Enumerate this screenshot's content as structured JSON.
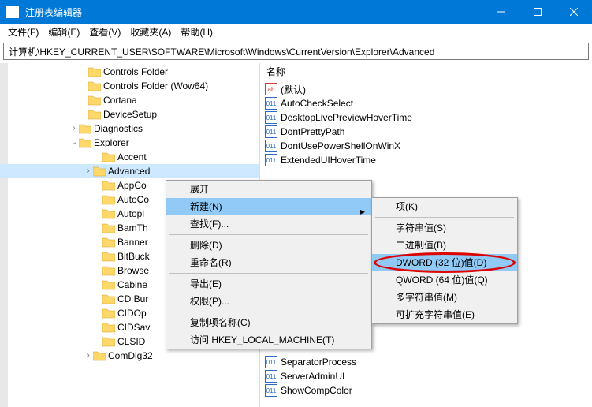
{
  "window": {
    "title": "注册表编辑器"
  },
  "menubar": [
    "文件(F)",
    "编辑(E)",
    "查看(V)",
    "收藏夹(A)",
    "帮助(H)"
  ],
  "address": "计算机\\HKEY_CURRENT_USER\\SOFTWARE\\Microsoft\\Windows\\CurrentVersion\\Explorer\\Advanced",
  "tree": [
    {
      "indent": 100,
      "exp": "",
      "label": "Controls Folder"
    },
    {
      "indent": 100,
      "exp": "",
      "label": "Controls Folder (Wow64)"
    },
    {
      "indent": 100,
      "exp": "",
      "label": "Cortana"
    },
    {
      "indent": 100,
      "exp": "",
      "label": "DeviceSetup"
    },
    {
      "indent": 88,
      "exp": ">",
      "label": "Diagnostics"
    },
    {
      "indent": 88,
      "exp": "v",
      "label": "Explorer"
    },
    {
      "indent": 118,
      "exp": "",
      "label": "Accent"
    },
    {
      "indent": 106,
      "exp": ">",
      "label": "Advanced",
      "selected": true
    },
    {
      "indent": 118,
      "exp": "",
      "label": "AppCo"
    },
    {
      "indent": 118,
      "exp": "",
      "label": "AutoCo"
    },
    {
      "indent": 118,
      "exp": "",
      "label": "Autopl"
    },
    {
      "indent": 118,
      "exp": "",
      "label": "BamTh"
    },
    {
      "indent": 118,
      "exp": "",
      "label": "Banner"
    },
    {
      "indent": 118,
      "exp": "",
      "label": "BitBuck"
    },
    {
      "indent": 118,
      "exp": "",
      "label": "Browse"
    },
    {
      "indent": 118,
      "exp": "",
      "label": "Cabine"
    },
    {
      "indent": 118,
      "exp": "",
      "label": "CD Bur"
    },
    {
      "indent": 118,
      "exp": "",
      "label": "CIDOp"
    },
    {
      "indent": 118,
      "exp": "",
      "label": "CIDSav"
    },
    {
      "indent": 118,
      "exp": "",
      "label": "CLSID"
    },
    {
      "indent": 106,
      "exp": ">",
      "label": "ComDlg32"
    }
  ],
  "right_header": "名称",
  "values": [
    {
      "icon": "ab",
      "label": "(默认)"
    },
    {
      "icon": "num",
      "label": "AutoCheckSelect"
    },
    {
      "icon": "num",
      "label": "DesktopLivePreviewHoverTime"
    },
    {
      "icon": "num",
      "label": "DontPrettyPath"
    },
    {
      "icon": "num",
      "label": "DontUsePowerShellOnWinX"
    },
    {
      "icon": "num",
      "label": "ExtendedUIHoverTime"
    },
    {
      "icon": "num",
      "label": "SeparatorProcess"
    },
    {
      "icon": "num",
      "label": "ServerAdminUI"
    },
    {
      "icon": "num",
      "label": "ShowCompColor"
    }
  ],
  "context_menu": {
    "items": [
      {
        "label": "展开"
      },
      {
        "label": "新建(N)",
        "submenu": true,
        "hover": true
      },
      {
        "label": "查找(F)..."
      },
      {
        "sep": true
      },
      {
        "label": "删除(D)"
      },
      {
        "label": "重命名(R)"
      },
      {
        "sep": true
      },
      {
        "label": "导出(E)"
      },
      {
        "label": "权限(P)..."
      },
      {
        "sep": true
      },
      {
        "label": "复制项名称(C)"
      },
      {
        "label": "访问 HKEY_LOCAL_MACHINE(T)"
      }
    ]
  },
  "submenu": {
    "items": [
      {
        "label": "项(K)"
      },
      {
        "sep": true
      },
      {
        "label": "字符串值(S)"
      },
      {
        "label": "二进制值(B)"
      },
      {
        "label": "DWORD (32 位)值(D)",
        "hover": true,
        "highlight": true
      },
      {
        "label": "QWORD (64 位)值(Q)"
      },
      {
        "label": "多字符串值(M)"
      },
      {
        "label": "可扩充字符串值(E)"
      }
    ]
  }
}
